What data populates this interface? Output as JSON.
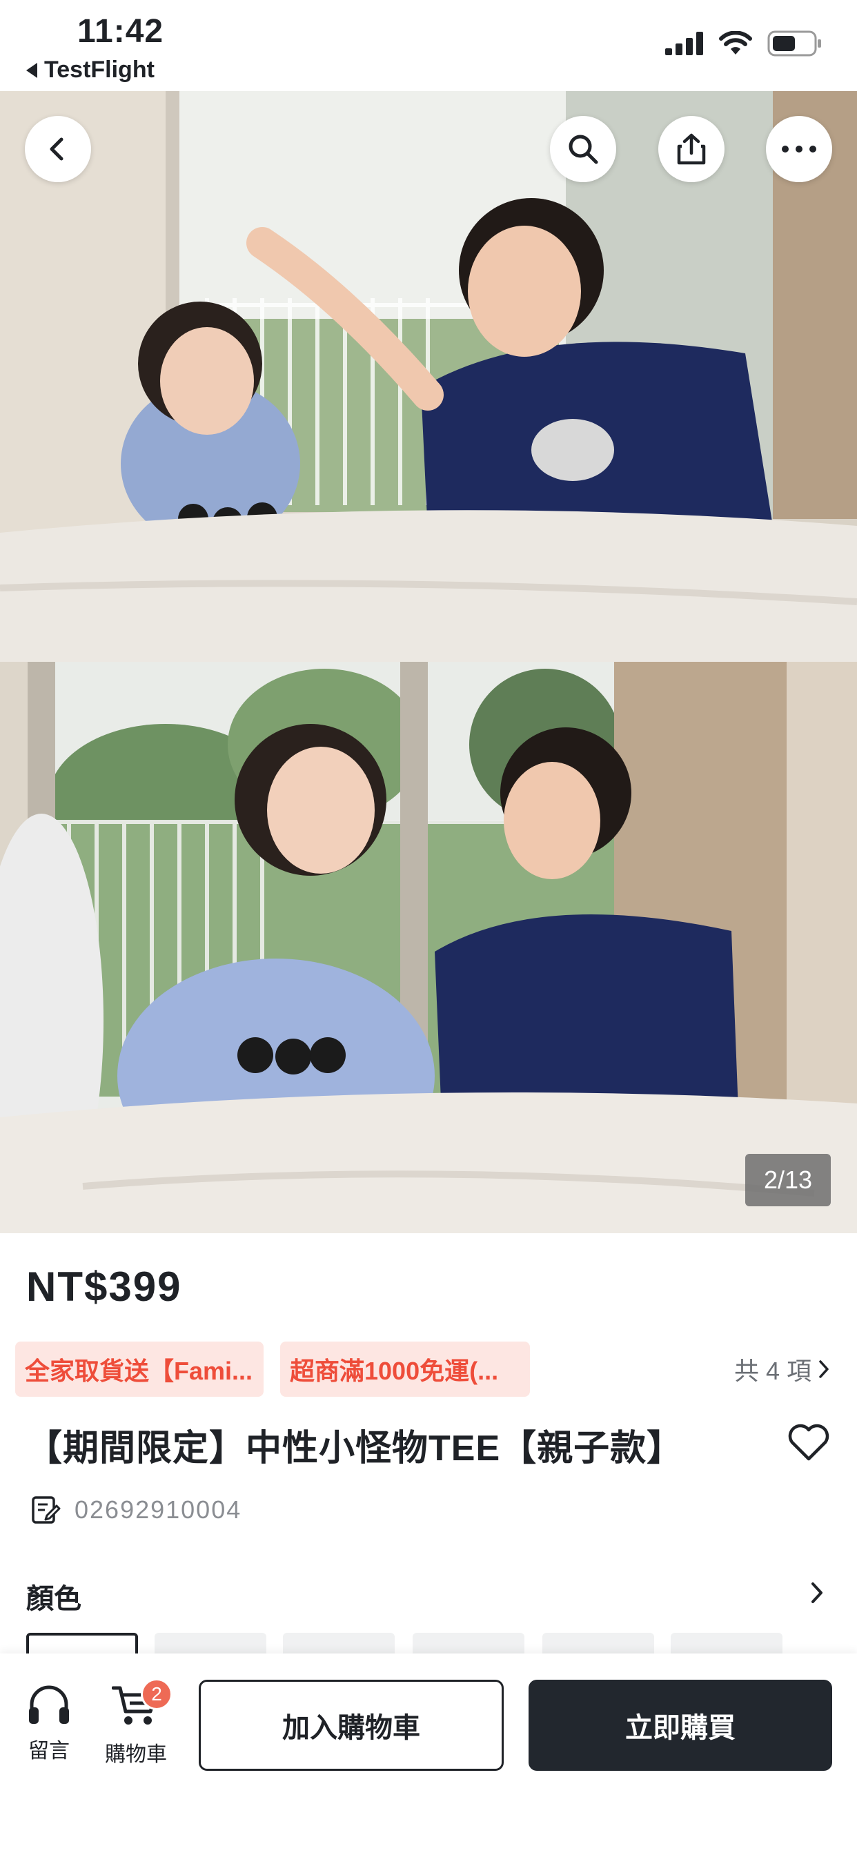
{
  "status_bar": {
    "time": "11:42",
    "back_app": "TestFlight"
  },
  "gallery": {
    "page_indicator": "2/13"
  },
  "product": {
    "price": "NT$399",
    "promos": [
      "全家取貨送【Fami...",
      "超商滿1000免運(..."
    ],
    "promo_count": "共 4 項",
    "title": "【期間限定】中性小怪物TEE【親子款】",
    "sku": "02692910004"
  },
  "options": {
    "color_label": "顏色"
  },
  "bottom_bar": {
    "message_label": "留言",
    "cart_label": "購物車",
    "cart_badge": "2",
    "add_to_cart": "加入購物車",
    "buy_now": "立即購買"
  },
  "colors": {
    "accent_red": "#ee4d3a",
    "promo_bg": "#fde6e2",
    "dark_button": "#22272e",
    "badge": "#ee6a55"
  },
  "icons": [
    "back-icon",
    "search-icon",
    "share-icon",
    "more-icon",
    "heart-icon",
    "edit-note-icon",
    "chevron-right-icon",
    "headset-icon",
    "cart-icon"
  ]
}
